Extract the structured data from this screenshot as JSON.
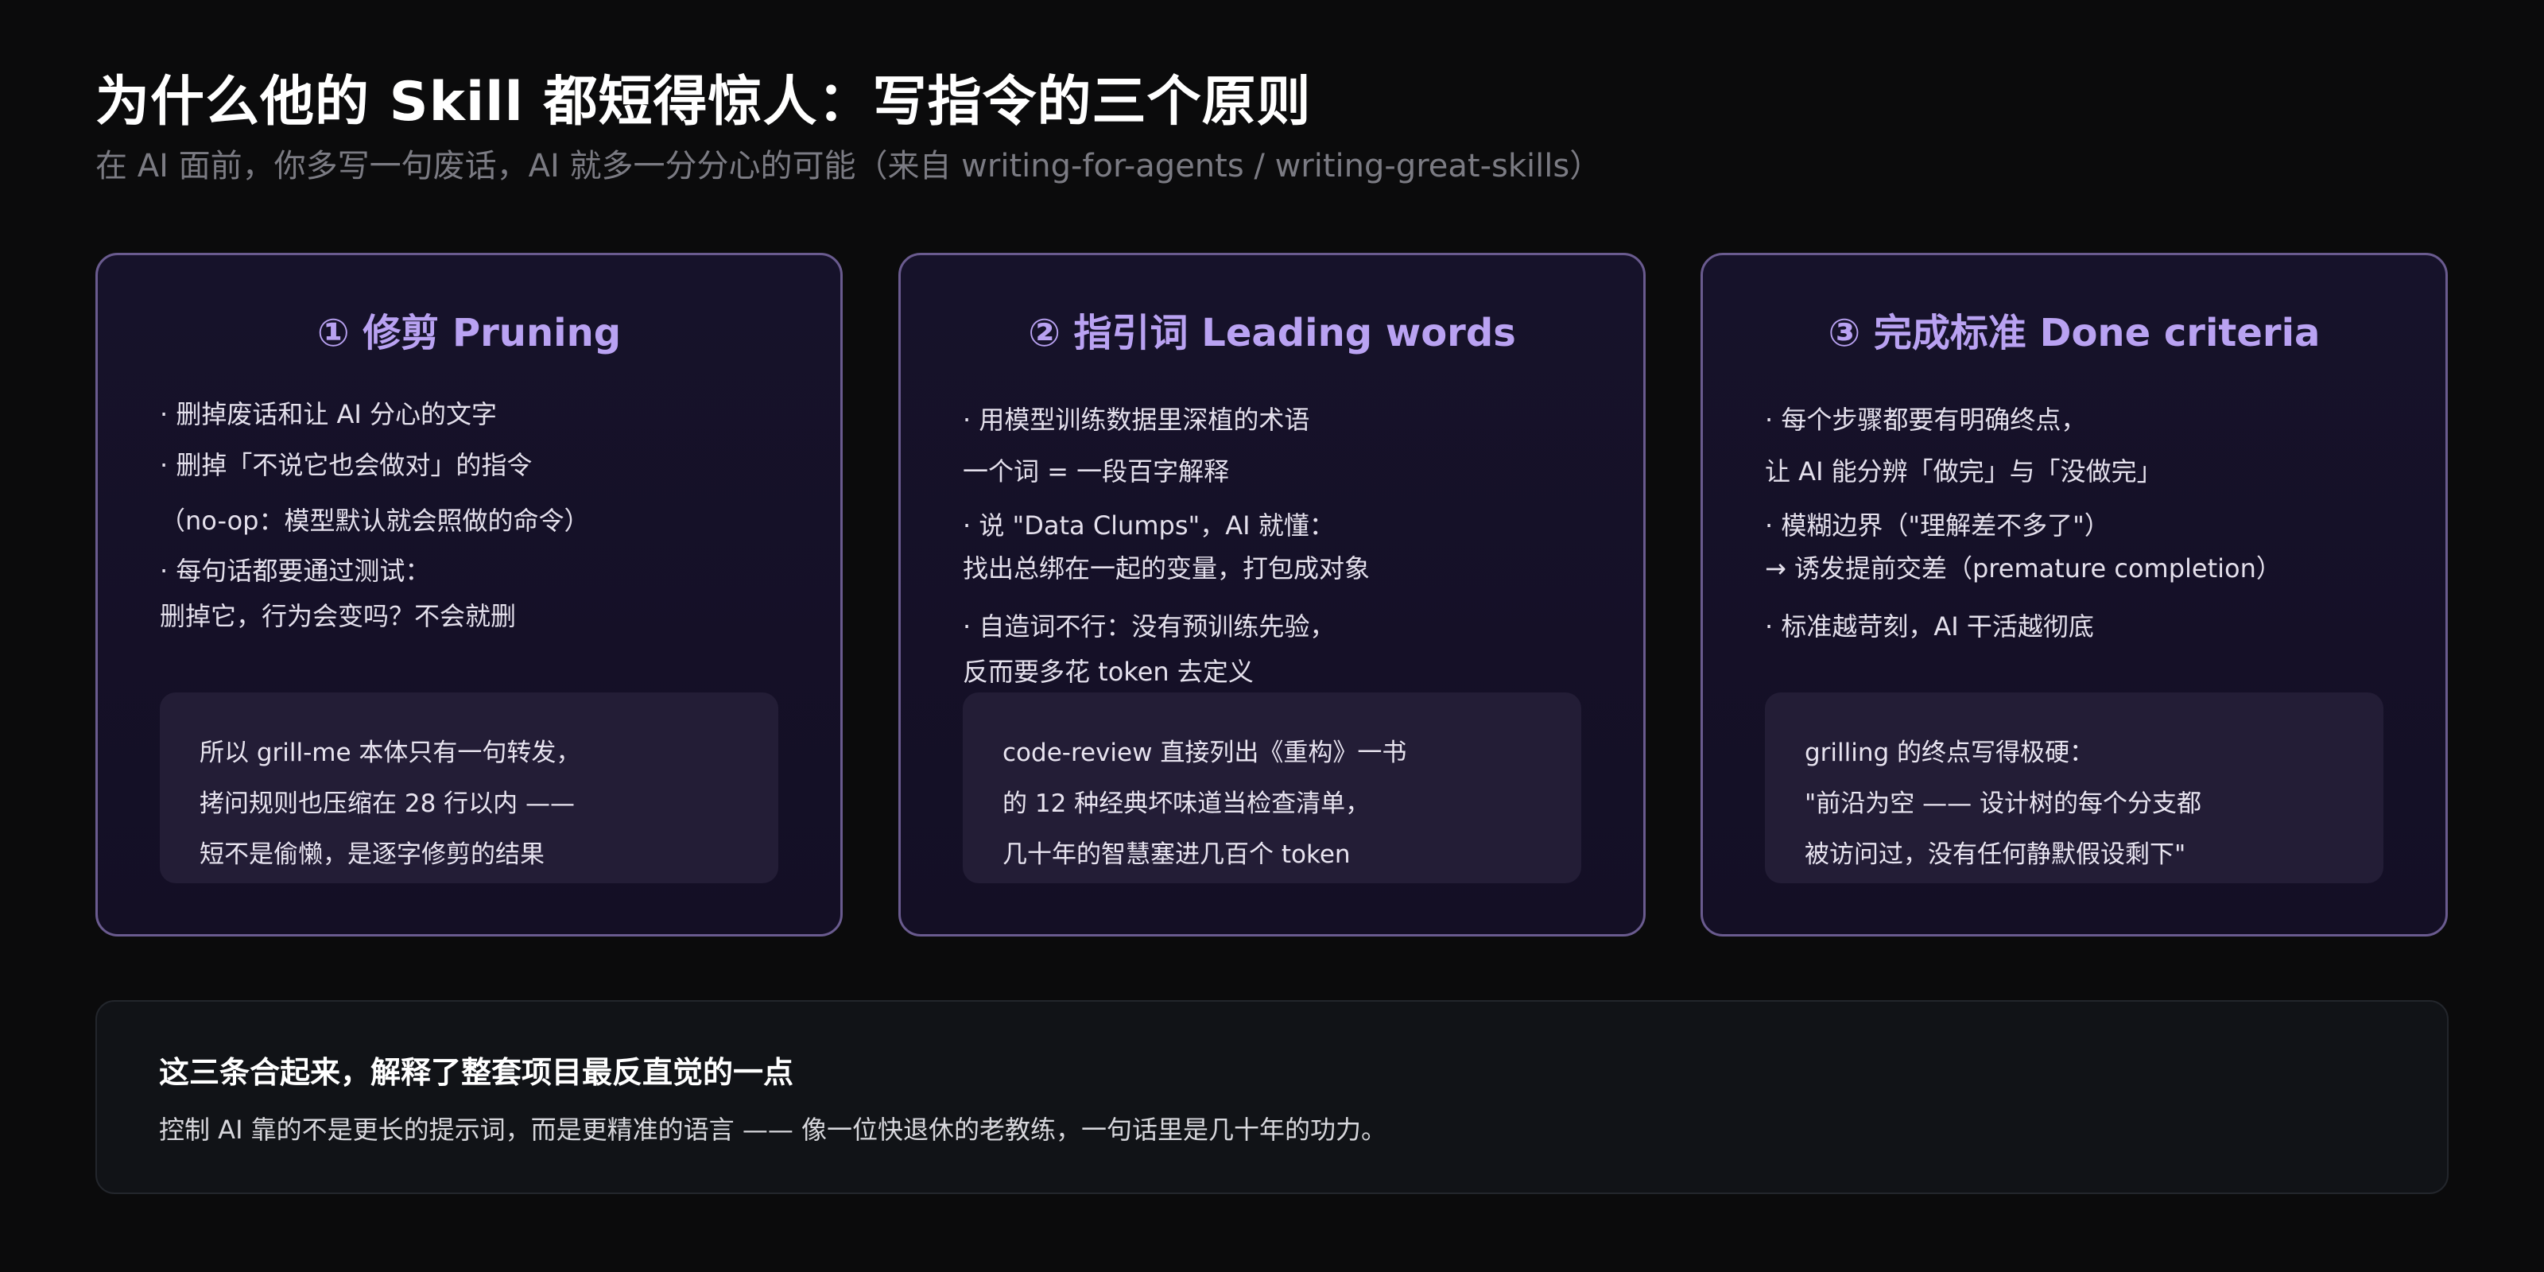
{
  "header": {
    "title": "为什么他的 Skill 都短得惊人：写指令的三个原则",
    "subtitle": "在 AI 面前，你多写一句废话，AI 就多一分分心的可能（来自 writing-for-agents / writing-great-skills）"
  },
  "cards": [
    {
      "title": "① 修剪 Pruning",
      "lines": [
        "· 删掉废话和让 AI 分心的文字",
        "· 删掉「不说它也会做对」的指令",
        "（no-op：模型默认就会照做的命令）",
        "· 每句话都要通过测试：",
        "删掉它，行为会变吗？不会就删"
      ],
      "callout": [
        "所以 grill-me 本体只有一句转发，",
        "拷问规则也压缩在 28 行以内 ——",
        "短不是偷懒，是逐字修剪的结果"
      ]
    },
    {
      "title": "② 指引词 Leading words",
      "lines": [
        "· 用模型训练数据里深植的术语",
        "一个词 = 一段百字解释",
        "· 说 \"Data Clumps\"，AI 就懂：",
        "找出总绑在一起的变量，打包成对象",
        "· 自造词不行：没有预训练先验，",
        "反而要多花 token 去定义"
      ],
      "callout": [
        "code-review 直接列出《重构》一书",
        "的 12 种经典坏味道当检查清单，",
        "几十年的智慧塞进几百个 token"
      ]
    },
    {
      "title": "③ 完成标准 Done criteria",
      "lines": [
        "· 每个步骤都要有明确终点，",
        "让 AI 能分辨「做完」与「没做完」",
        "· 模糊边界（\"理解差不多了\"）",
        "→ 诱发提前交差（premature completion）",
        "· 标准越苛刻，AI 干活越彻底"
      ],
      "callout": [
        "grilling 的终点写得极硬：",
        "\"前沿为空 —— 设计树的每个分支都",
        "被访问过，没有任何静默假设剩下\""
      ]
    }
  ],
  "summary": {
    "title": "这三条合起来，解释了整套项目最反直觉的一点",
    "text": "控制 AI 靠的不是更长的提示词，而是更精准的语言 —— 像一位快退休的老教练，一句话里是几十年的功力。"
  }
}
